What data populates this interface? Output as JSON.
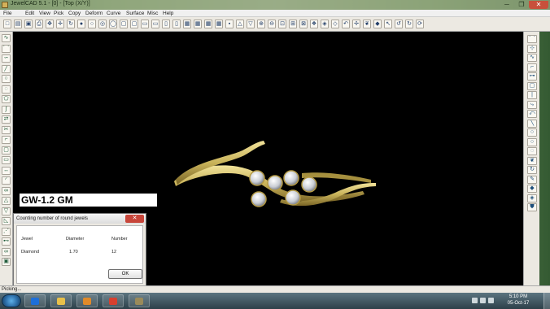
{
  "window": {
    "title": "JewelCAD 5.1 - [0] - [Top (X/Y)]",
    "min_glyph": "─",
    "max_glyph": "❐",
    "close_glyph": "✕"
  },
  "menu": [
    "File",
    "Edit",
    "View",
    "Pick",
    "Copy",
    "Deform",
    "Curve",
    "Surface",
    "Misc",
    "Help"
  ],
  "toolbar": {
    "icons": [
      "new-file-icon",
      "open-folder-icon",
      "save-icon",
      "print-icon",
      "pointer-icon",
      "cross-icon",
      "rotate-icon",
      "sphere-icon",
      "circle-icon",
      "target-icon",
      "circle-outline-icon",
      "square-icon",
      "square-icon",
      "frame-icon",
      "frame-icon",
      "window-icon",
      "window-icon",
      "grid-icon",
      "grid-icon",
      "grid-icon",
      "grid-icon",
      "box-icon",
      "triangle-up-icon",
      "triangle-down-icon",
      "zoom-in-icon",
      "zoom-out-icon",
      "zoom-window-icon",
      "zoom-fit-icon",
      "zoom-all-icon",
      "render-icon",
      "shaded-icon",
      "wire-icon",
      "undo-arrow-icon",
      "move-icon",
      "leaf-icon",
      "gem-icon",
      "select-icon",
      "undo-icon",
      "redo-icon",
      "repeat-icon"
    ],
    "glyphs": [
      "□",
      "▤",
      "▣",
      "⎙",
      "✥",
      "✛",
      "↻",
      "●",
      "○",
      "◎",
      "◯",
      "▢",
      "▢",
      "▭",
      "▭",
      "▯",
      "▯",
      "▦",
      "▦",
      "▦",
      "▦",
      "▪",
      "△",
      "▽",
      "⊕",
      "⊖",
      "⊡",
      "⊞",
      "⊠",
      "❖",
      "◈",
      "◇",
      "↶",
      "✢",
      "❦",
      "◆",
      "↖",
      "↺",
      "↻",
      "⟳"
    ]
  },
  "left_tools": {
    "icons": [
      "curve-icon",
      "arc-icon",
      "spline-icon",
      "line-icon",
      "circle-tool-icon",
      "ellipse-icon",
      "polygon-icon",
      "bezier-icon",
      "offset-icon",
      "trim-icon",
      "fillet-icon",
      "square-select-icon",
      "rectangle-icon",
      "scale-icon",
      "arc-tool-icon",
      "loop-icon",
      "triangle-icon",
      "triangle-down-tool-icon",
      "corner-icon",
      "bevel-icon",
      "link-icon",
      "double-loop-icon",
      "box-tool-icon"
    ],
    "glyphs": [
      "∿",
      "⌒",
      "∽",
      "╱",
      "○",
      "◌",
      "⬠",
      "∫",
      "⇄",
      "✂",
      "⌐",
      "▢",
      "▭",
      "↔",
      "◜",
      "∞",
      "△",
      "▽",
      "◺",
      "⋰",
      "⊷",
      "∞",
      "▣"
    ]
  },
  "right_tools": {
    "icons": [
      "curve-icon",
      "node-icon",
      "wave-icon",
      "corner-icon",
      "link-icon",
      "frame-icon",
      "pipe-icon",
      "bend-icon",
      "twist-icon",
      "tilt-icon",
      "circle-icon",
      "circle-icon",
      "circle-icon",
      "leaf-icon",
      "loop-icon",
      "pencil-icon",
      "diamond-icon",
      "gem-icon",
      "shield-icon"
    ],
    "glyphs": [
      "⌒",
      "⊹",
      "∿",
      "⌐",
      "⊶",
      "▢",
      "∣",
      "⤷",
      "⤺",
      "╲",
      "○",
      "○",
      "◌",
      "❦",
      "↻",
      "✎",
      "◆",
      "◈",
      "⛊"
    ]
  },
  "viewport": {
    "background": "#000000",
    "weight_label": "GW-1.2 GM",
    "ring_color": "#c9b35a",
    "gem_color": "#e6e8ec"
  },
  "dialog": {
    "title": "Counting number of round jewels",
    "close_glyph": "✕",
    "columns": [
      "Jewel",
      "Diameter",
      "Number"
    ],
    "rows": [
      [
        "Diamond",
        "1.70",
        "12"
      ]
    ],
    "ok_label": "OK"
  },
  "status": {
    "text": "Picking..."
  },
  "taskbar": {
    "apps": [
      "ie-icon",
      "explorer-icon",
      "media-player-icon",
      "chrome-icon",
      "jewelcad-icon"
    ],
    "app_colors": [
      "#1e6fd9",
      "#e8c04a",
      "#e08a2a",
      "#d8402f",
      "#9a8a5a"
    ],
    "tray": [
      "tray-icon",
      "network-icon",
      "volume-icon"
    ],
    "time": "5:10 PM",
    "date": "05-Oct-17"
  }
}
